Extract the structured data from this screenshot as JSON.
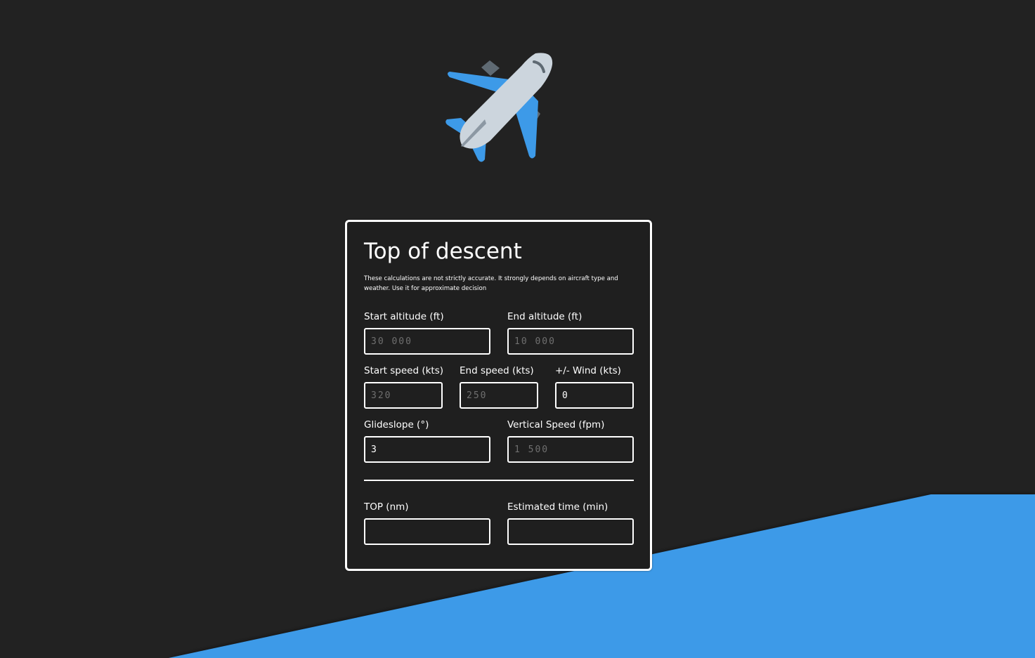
{
  "colors": {
    "background": "#222222",
    "accent": "#3d9ae8",
    "card_bg": "#1f1f1f",
    "border": "#ffffff",
    "placeholder": "#6f6f6f"
  },
  "logo": {
    "icon": "airplane-icon"
  },
  "form": {
    "title": "Top of descent",
    "disclaimer": "These calculations are not strictly accurate. It strongly depends on aircraft type and weather. Use it for approximate decision",
    "start_altitude": {
      "label": "Start altitude (ft)",
      "placeholder": "30 000",
      "value": ""
    },
    "end_altitude": {
      "label": "End altitude (ft)",
      "placeholder": "10 000",
      "value": ""
    },
    "start_speed": {
      "label": "Start speed (kts)",
      "placeholder": "320",
      "value": ""
    },
    "end_speed": {
      "label": "End speed (kts)",
      "placeholder": "250",
      "value": ""
    },
    "wind": {
      "label": "+/- Wind (kts)",
      "placeholder": "",
      "value": "0"
    },
    "glideslope": {
      "label": "Glideslope (°)",
      "placeholder": "",
      "value": "3"
    },
    "vertical_speed": {
      "label": "Vertical Speed (fpm)",
      "placeholder": "1 500",
      "value": ""
    },
    "top_result": {
      "label": "TOP (nm)",
      "value": ""
    },
    "time_result": {
      "label": "Estimated time (min)",
      "value": ""
    }
  }
}
